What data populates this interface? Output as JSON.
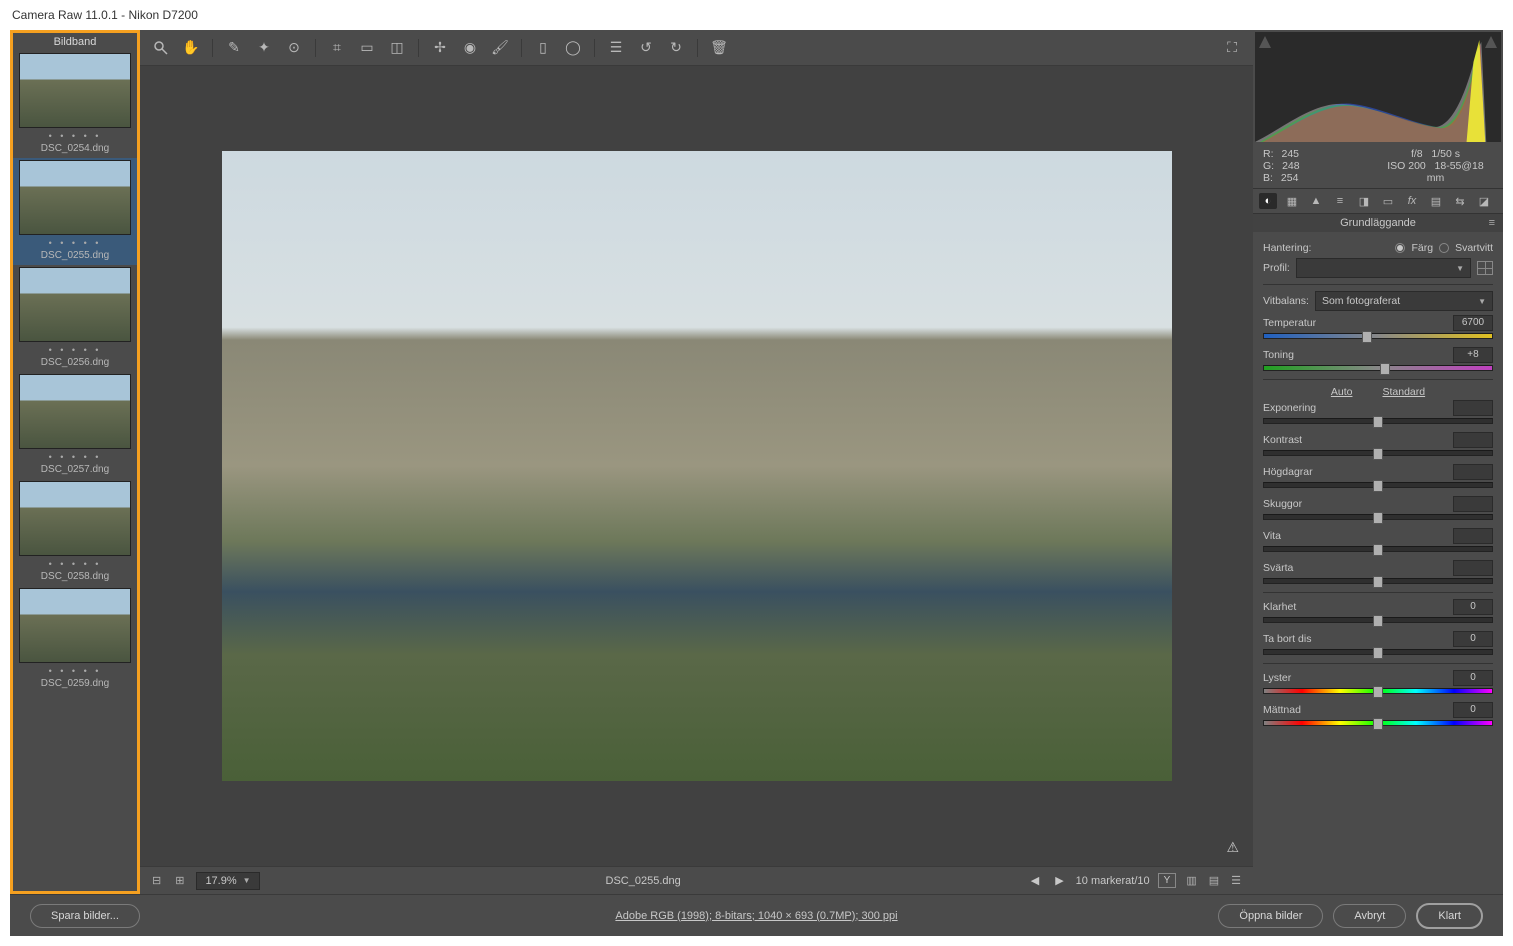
{
  "window_title": "Camera Raw 11.0.1  -  Nikon D7200",
  "filmstrip": {
    "header": "Bildband",
    "items": [
      {
        "name": "DSC_0254.dng",
        "selected": false
      },
      {
        "name": "DSC_0255.dng",
        "selected": true
      },
      {
        "name": "DSC_0256.dng",
        "selected": false
      },
      {
        "name": "DSC_0257.dng",
        "selected": false
      },
      {
        "name": "DSC_0258.dng",
        "selected": false
      },
      {
        "name": "DSC_0259.dng",
        "selected": false
      }
    ]
  },
  "zoom": "17.9%",
  "current_file": "DSC_0255.dng",
  "selection_status": "10 markerat/10",
  "readout": {
    "r_label": "R:",
    "r_value": "245",
    "g_label": "G:",
    "g_value": "248",
    "b_label": "B:",
    "b_value": "254",
    "aperture": "f/8",
    "shutter": "1/50 s",
    "iso": "ISO 200",
    "lens": "18-55@18 mm"
  },
  "panel_title": "Grundläggande",
  "treatment": {
    "label": "Hantering:",
    "color": "Färg",
    "bw": "Svartvitt"
  },
  "profile_label": "Profil:",
  "wb": {
    "label": "Vitbalans:",
    "value": "Som fotograferat"
  },
  "links": {
    "auto": "Auto",
    "standard": "Standard"
  },
  "sliders": {
    "temperatur": {
      "label": "Temperatur",
      "value": "6700",
      "pos": 45
    },
    "toning": {
      "label": "Toning",
      "value": "+8",
      "pos": 53
    },
    "exponering": {
      "label": "Exponering",
      "value": "",
      "pos": 50
    },
    "kontrast": {
      "label": "Kontrast",
      "value": "",
      "pos": 50
    },
    "hogdagrar": {
      "label": "Högdagrar",
      "value": "",
      "pos": 50
    },
    "skuggor": {
      "label": "Skuggor",
      "value": "",
      "pos": 50
    },
    "vita": {
      "label": "Vita",
      "value": "",
      "pos": 50
    },
    "svarta": {
      "label": "Svärta",
      "value": "",
      "pos": 50
    },
    "klarhet": {
      "label": "Klarhet",
      "value": "0",
      "pos": 50
    },
    "tabortdis": {
      "label": "Ta bort dis",
      "value": "0",
      "pos": 50
    },
    "lyster": {
      "label": "Lyster",
      "value": "0",
      "pos": 50
    },
    "mattnad": {
      "label": "Mättnad",
      "value": "0",
      "pos": 50
    }
  },
  "footer": {
    "save": "Spara bilder...",
    "workflow": "Adobe RGB (1998); 8-bitars; 1040 × 693 (0.7MP); 300 ppi",
    "open": "Öppna bilder",
    "cancel": "Avbryt",
    "done": "Klart"
  }
}
